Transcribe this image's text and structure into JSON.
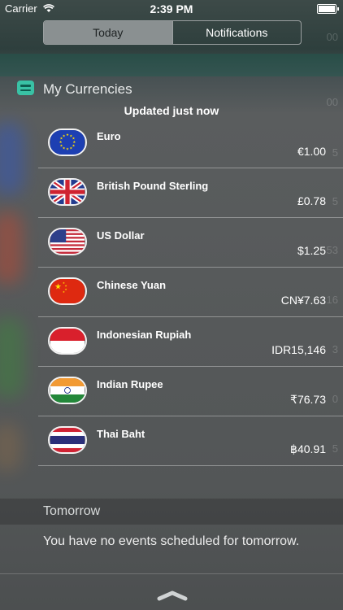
{
  "status_bar": {
    "carrier": "Carrier",
    "time": "2:39 PM"
  },
  "segmented": {
    "today": "Today",
    "notifications": "Notifications",
    "selected": "Today"
  },
  "widget": {
    "title": "My Currencies",
    "updated": "Updated just now",
    "currencies": [
      {
        "name": "Euro",
        "value": "€1.00",
        "flag": "eu-flag-icon"
      },
      {
        "name": "British Pound Sterling",
        "value": "£0.78",
        "flag": "uk-flag-icon"
      },
      {
        "name": "US Dollar",
        "value": "$1.25",
        "flag": "us-flag-icon"
      },
      {
        "name": "Chinese Yuan",
        "value": "CN¥7.63",
        "flag": "china-flag-icon"
      },
      {
        "name": "Indonesian Rupiah",
        "value": "IDR15,146",
        "flag": "indonesia-flag-icon"
      },
      {
        "name": "Indian Rupee",
        "value": "₹76.73",
        "flag": "india-flag-icon"
      },
      {
        "name": "Thai Baht",
        "value": "฿40.91",
        "flag": "thailand-flag-icon"
      }
    ]
  },
  "tomorrow": {
    "title": "Tomorrow",
    "message": "You have no events scheduled for tomorrow."
  },
  "background_ghost_text": [
    "00",
    "00",
    "5",
    "5",
    "53",
    "16",
    "3",
    "0",
    "5"
  ],
  "colors": {
    "accent": "#39c2a5",
    "panel_bg": "#555859"
  }
}
